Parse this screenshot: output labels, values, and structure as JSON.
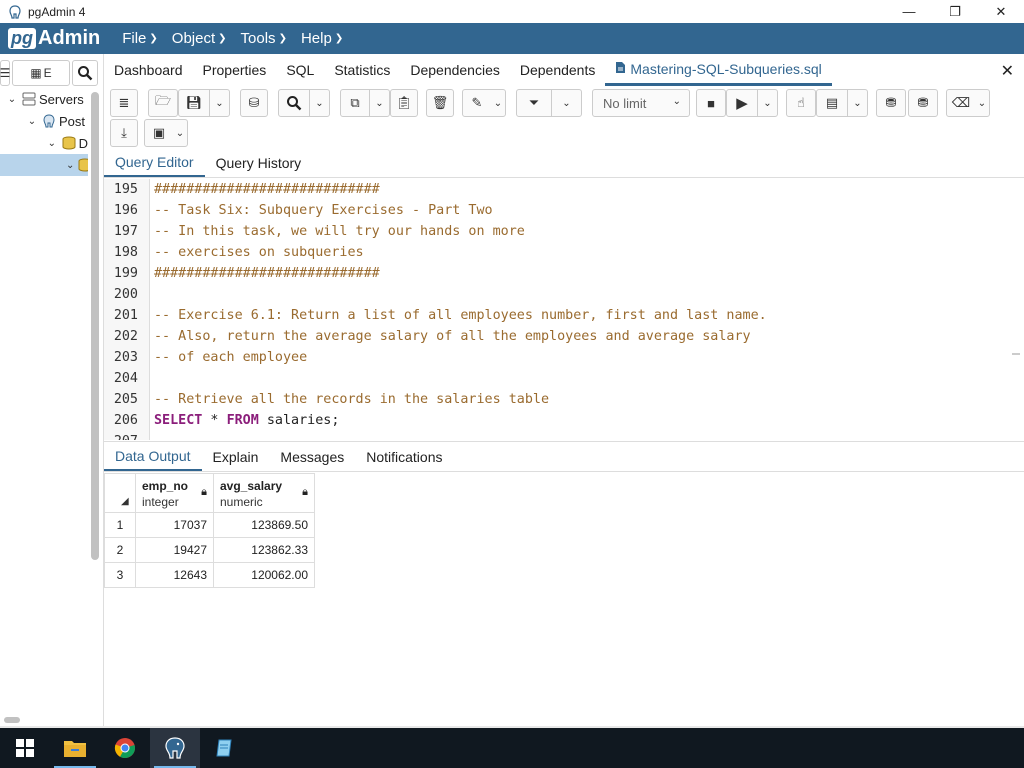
{
  "window": {
    "title": "pgAdmin 4",
    "app_icon": "elephant-icon",
    "minimize": "—",
    "maximize": "❐",
    "close": "✕"
  },
  "menubar": {
    "logo_pg": "pg",
    "logo_admin": "Admin",
    "items": [
      "File",
      "Object",
      "Tools",
      "Help"
    ]
  },
  "browser": {
    "toolbar_filter_label": "E",
    "tree": [
      {
        "label": "Servers",
        "icon": "server-icon",
        "expanded": true
      },
      {
        "label": "Post",
        "icon": "elephant-icon",
        "expanded": true
      },
      {
        "label": "D",
        "icon": "database-icon",
        "expanded": true
      },
      {
        "label": "",
        "icon": "database-icon",
        "expanded": true,
        "selected": true
      }
    ]
  },
  "tabs": [
    {
      "label": "Dashboard"
    },
    {
      "label": "Properties"
    },
    {
      "label": "SQL"
    },
    {
      "label": "Statistics"
    },
    {
      "label": "Dependencies"
    },
    {
      "label": "Dependents"
    },
    {
      "label": "Mastering-SQL-Subqueries.sql",
      "active": true
    }
  ],
  "toolbar": {
    "limit_value": "No limit"
  },
  "editor_tabs": [
    {
      "label": "Query Editor",
      "active": true
    },
    {
      "label": "Query History"
    }
  ],
  "editor": {
    "lines": [
      {
        "n": "195",
        "text": "############################",
        "kind": "comment"
      },
      {
        "n": "196",
        "text": "-- Task Six: Subquery Exercises - Part Two",
        "kind": "comment"
      },
      {
        "n": "197",
        "text": "-- In this task, we will try our hands on more",
        "kind": "comment"
      },
      {
        "n": "198",
        "text": "-- exercises on subqueries",
        "kind": "comment"
      },
      {
        "n": "199",
        "text": "############################",
        "kind": "comment"
      },
      {
        "n": "200",
        "text": "",
        "kind": "comment"
      },
      {
        "n": "201",
        "text": "-- Exercise 6.1: Return a list of all employees number, first and last name.",
        "kind": "comment"
      },
      {
        "n": "202",
        "text": "-- Also, return the average salary of all the employees and average salary",
        "kind": "comment"
      },
      {
        "n": "203",
        "text": "-- of each employee",
        "kind": "comment"
      },
      {
        "n": "204",
        "text": "",
        "kind": "comment"
      },
      {
        "n": "205",
        "text": "-- Retrieve all the records in the salaries table",
        "kind": "comment"
      },
      {
        "n": "206",
        "kw1": "SELECT",
        "mid": " * ",
        "kw2": "FROM",
        "rest": " salaries;",
        "kind": "sql"
      },
      {
        "n": "207",
        "text": "",
        "kind": "comment"
      }
    ]
  },
  "output_tabs": [
    {
      "label": "Data Output",
      "active": true
    },
    {
      "label": "Explain"
    },
    {
      "label": "Messages"
    },
    {
      "label": "Notifications"
    }
  ],
  "grid": {
    "columns": [
      {
        "name": "emp_no",
        "type": "integer"
      },
      {
        "name": "avg_salary",
        "type": "numeric"
      }
    ],
    "rows": [
      {
        "idx": "1",
        "emp_no": "17037",
        "avg_salary": "123869.50"
      },
      {
        "idx": "2",
        "emp_no": "19427",
        "avg_salary": "123862.33"
      },
      {
        "idx": "3",
        "emp_no": "12643",
        "avg_salary": "120062.00"
      }
    ]
  },
  "taskbar": {
    "items": [
      "windows-start-icon",
      "file-explorer-icon",
      "chrome-icon",
      "pgadmin-icon",
      "notepad-icon"
    ]
  }
}
